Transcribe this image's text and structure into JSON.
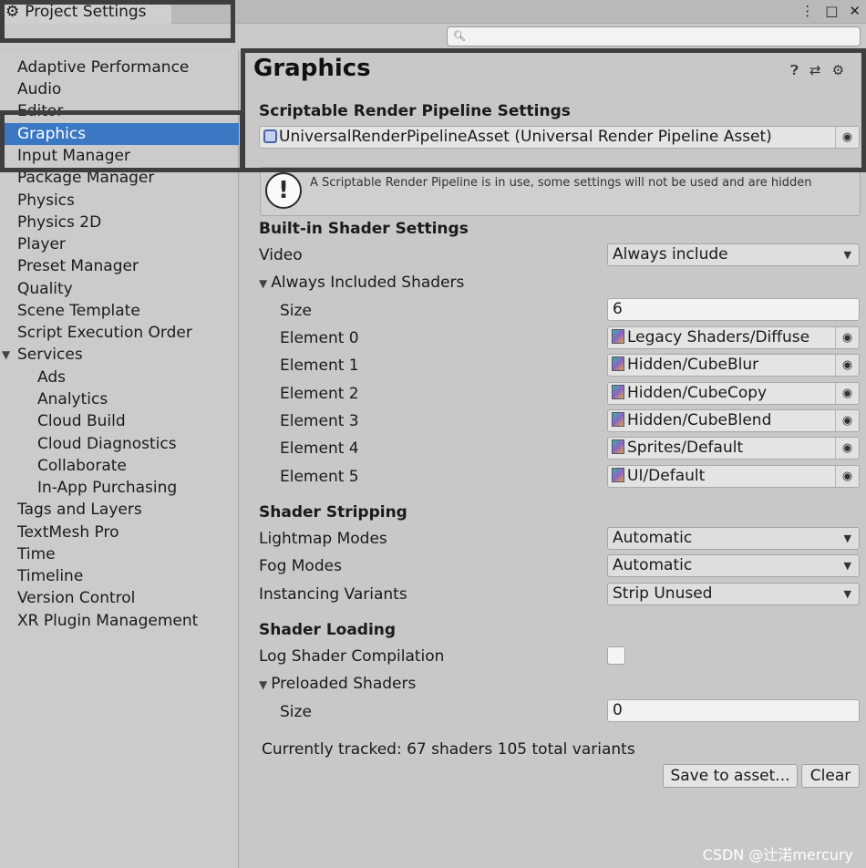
{
  "window": {
    "tab_title": "Project Settings",
    "menu_icon": "⋮",
    "maximize_icon": "□",
    "close_icon": "✕",
    "search_placeholder": ""
  },
  "sidebar": {
    "items": [
      {
        "label": "Adaptive Performance"
      },
      {
        "label": "Audio"
      },
      {
        "label": "Editor"
      },
      {
        "label": "Graphics",
        "selected": true
      },
      {
        "label": "Input Manager"
      },
      {
        "label": "Package Manager"
      },
      {
        "label": "Physics"
      },
      {
        "label": "Physics 2D"
      },
      {
        "label": "Player"
      },
      {
        "label": "Preset Manager"
      },
      {
        "label": "Quality"
      },
      {
        "label": "Scene Template"
      },
      {
        "label": "Script Execution Order"
      },
      {
        "label": "Services",
        "expanded": true
      },
      {
        "label": "Ads"
      },
      {
        "label": "Analytics"
      },
      {
        "label": "Cloud Build"
      },
      {
        "label": "Cloud Diagnostics"
      },
      {
        "label": "Collaborate"
      },
      {
        "label": "In-App Purchasing"
      },
      {
        "label": "Tags and Layers"
      },
      {
        "label": "TextMesh Pro"
      },
      {
        "label": "Time"
      },
      {
        "label": "Timeline"
      },
      {
        "label": "Version Control"
      },
      {
        "label": "XR Plugin Management"
      }
    ]
  },
  "main": {
    "title": "Graphics",
    "header_icons": [
      "help-icon",
      "preset-icon",
      "gear-icon"
    ],
    "srp": {
      "heading": "Scriptable Render Pipeline Settings",
      "asset": "UniversalRenderPipelineAsset (Universal Render Pipeline Asset)"
    },
    "warning": "A Scriptable Render Pipeline is in use, some settings will not be used and are hidden",
    "builtin": {
      "heading": "Built-in Shader Settings",
      "video_label": "Video",
      "video_value": "Always include",
      "always_included_label": "Always Included Shaders",
      "size_label": "Size",
      "size_value": "6",
      "elements": [
        {
          "label": "Element 0",
          "value": "Legacy Shaders/Diffuse"
        },
        {
          "label": "Element 1",
          "value": "Hidden/CubeBlur"
        },
        {
          "label": "Element 2",
          "value": "Hidden/CubeCopy"
        },
        {
          "label": "Element 3",
          "value": "Hidden/CubeBlend"
        },
        {
          "label": "Element 4",
          "value": "Sprites/Default"
        },
        {
          "label": "Element 5",
          "value": "UI/Default"
        }
      ]
    },
    "stripping": {
      "heading": "Shader Stripping",
      "lightmap_label": "Lightmap Modes",
      "lightmap_value": "Automatic",
      "fog_label": "Fog Modes",
      "fog_value": "Automatic",
      "instancing_label": "Instancing Variants",
      "instancing_value": "Strip Unused"
    },
    "loading": {
      "heading": "Shader Loading",
      "log_label": "Log Shader Compilation",
      "log_checked": false,
      "preloaded_label": "Preloaded Shaders",
      "size_label": "Size",
      "size_value": "0"
    },
    "tracked": "Currently tracked: 67 shaders 105 total variants",
    "save_button": "Save to asset...",
    "clear_button": "Clear"
  },
  "watermark": "CSDN @辻渃mercury",
  "colors": {
    "selection": "#3a78c3",
    "panel": "#c8c8c8",
    "annotation": "#3e3e3e"
  }
}
